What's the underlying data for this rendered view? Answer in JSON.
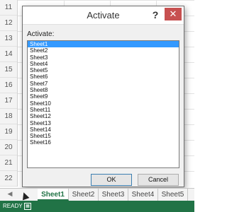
{
  "row_numbers": [
    "11",
    "12",
    "13",
    "14",
    "15",
    "16",
    "17",
    "18",
    "19",
    "20",
    "21",
    "22"
  ],
  "dialog": {
    "title": "Activate",
    "help_glyph": "?",
    "close_glyph": "✕",
    "list_label": "Activate:",
    "sheets": [
      "Sheet1",
      "Sheet2",
      "Sheet3",
      "Sheet4",
      "Sheet5",
      "Sheet6",
      "Sheet7",
      "Sheet8",
      "Sheet9",
      "Sheet10",
      "Sheet11",
      "Sheet12",
      "Sheet13",
      "Sheet14",
      "Sheet15",
      "Sheet16"
    ],
    "selected_sheet": "Sheet1",
    "ok_label": "OK",
    "cancel_label": "Cancel"
  },
  "tabs": {
    "prev_glyph": "◀",
    "items": [
      "Sheet1",
      "Sheet2",
      "Sheet3",
      "Sheet4",
      "Sheet5"
    ],
    "active": "Sheet1"
  },
  "status": {
    "text": "READY",
    "icon": "macro-record-icon"
  },
  "colors": {
    "accent_green": "#217346",
    "selection_blue": "#3399ff",
    "close_red": "#c75050"
  }
}
